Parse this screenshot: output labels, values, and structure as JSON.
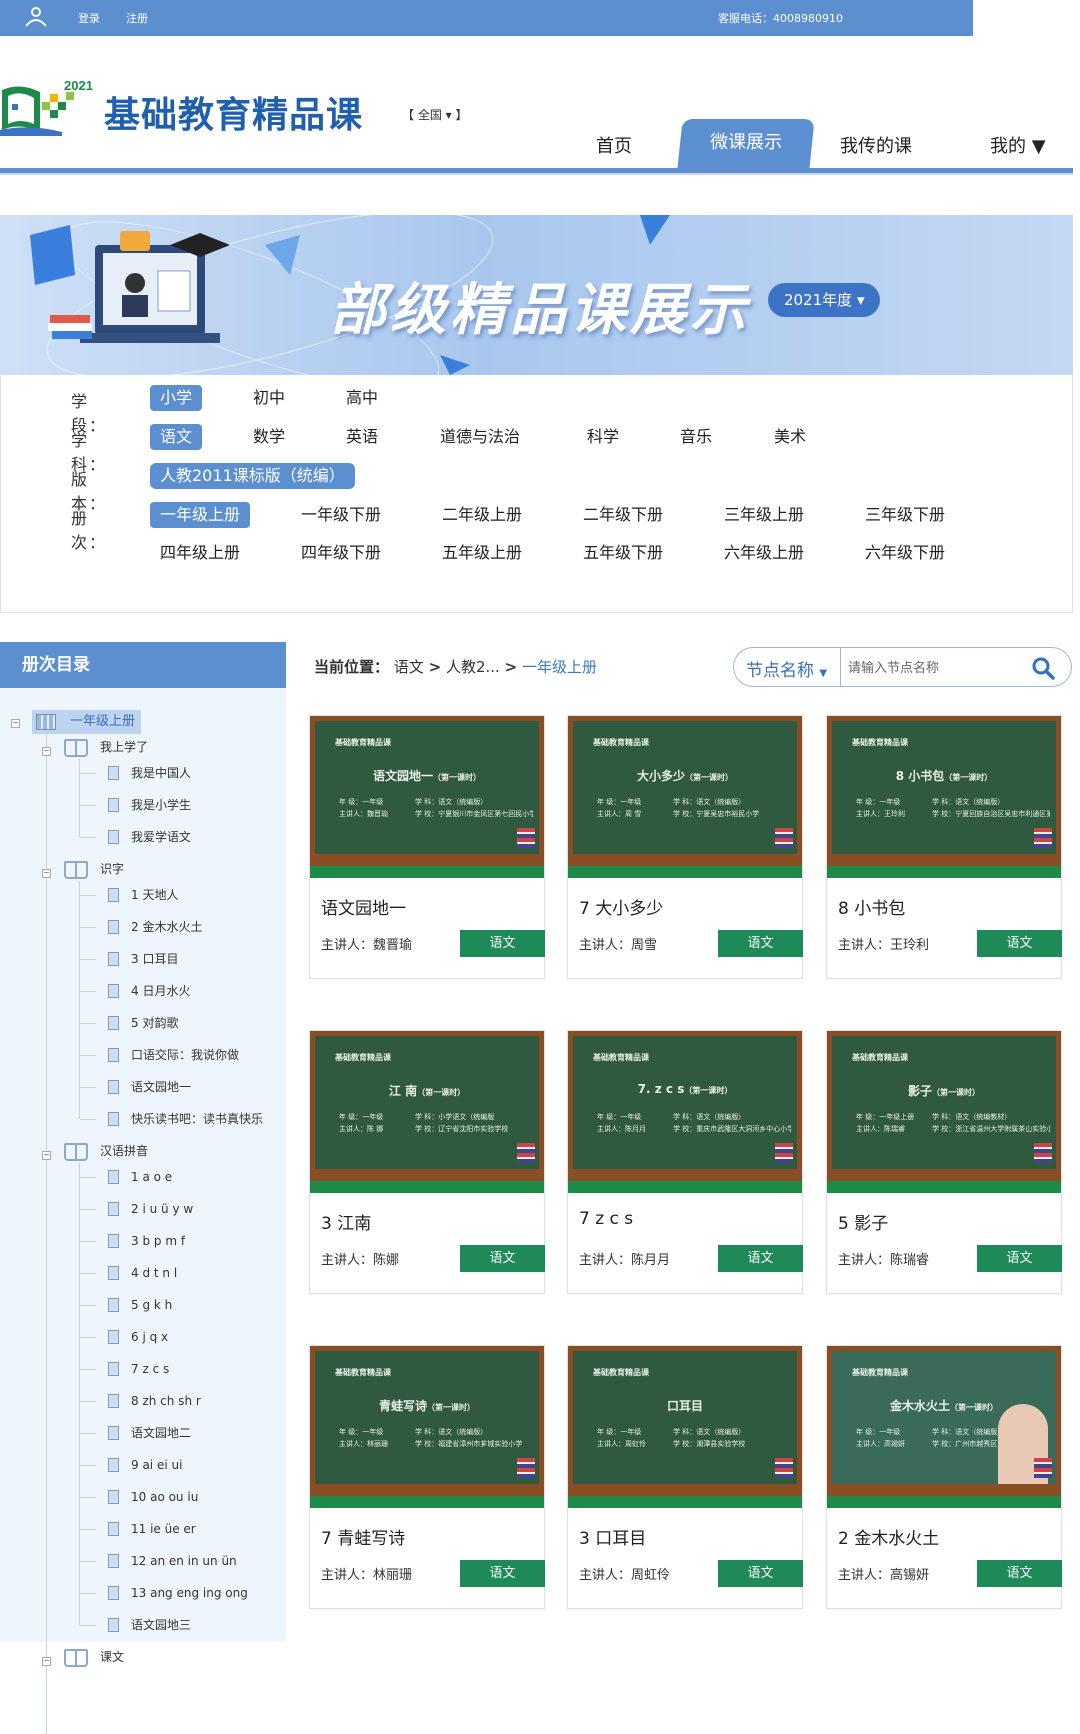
{
  "topbar": {
    "login": "登录",
    "register": "注册",
    "hotline": "客服电话：4008980910"
  },
  "header": {
    "logo_year": "2021",
    "site_title": "基础教育精品课",
    "region": "【 全国 ▾ 】",
    "nav": [
      {
        "label": "首页"
      },
      {
        "label": "微课展示"
      },
      {
        "label": "我传的课"
      },
      {
        "label": "我的 ▼"
      }
    ],
    "active_nav": "微课展示"
  },
  "banner": {
    "title": "部级精品课展示",
    "year_badge": "2021年度 ▾"
  },
  "filters": {
    "stage": {
      "label": "学 段：",
      "options": [
        "小学",
        "初中",
        "高中"
      ],
      "selected": "小学"
    },
    "subject": {
      "label": "学 科：",
      "options": [
        "语文",
        "数学",
        "英语",
        "道德与法治",
        "科学",
        "音乐",
        "美术"
      ],
      "selected": "语文"
    },
    "edition": {
      "label": "版 本：",
      "options": [
        "人教2011课标版（统编）"
      ],
      "selected": "人教2011课标版（统编）"
    },
    "volume": {
      "label": "册 次：",
      "options": [
        "一年级上册",
        "一年级下册",
        "二年级上册",
        "二年级下册",
        "三年级上册",
        "三年级下册",
        "四年级上册",
        "四年级下册",
        "五年级上册",
        "五年级下册",
        "六年级上册",
        "六年级下册"
      ],
      "selected": "一年级上册"
    }
  },
  "sidebar": {
    "title": "册次目录",
    "root": "一年级上册",
    "groups": [
      {
        "label": "我上学了",
        "items": [
          "我是中国人",
          "我是小学生",
          "我爱学语文"
        ]
      },
      {
        "label": "识字",
        "items": [
          "1 天地人",
          "2 金木水火土",
          "3 口耳目",
          "4 日月水火",
          "5 对韵歌",
          "口语交际：我说你做",
          "语文园地一",
          "快乐读书吧：读书真快乐"
        ]
      },
      {
        "label": "汉语拼音",
        "items": [
          "1 a o e",
          "2 i u ü y w",
          "3 b p m f",
          "4 d t n l",
          "5 g k h",
          "6 j q x",
          "7 z c s",
          "8 zh ch sh r",
          "语文园地二",
          "9 ai ei ui",
          "10 ao ou iu",
          "11 ie üe er",
          "12 an en in un ün",
          "13 ang eng ing ong",
          "语文园地三"
        ]
      },
      {
        "label": "课文",
        "items": []
      }
    ]
  },
  "breadcrumb": {
    "label": "当前位置：",
    "items": [
      "语文",
      ">",
      "人教2...",
      ">"
    ],
    "current": "一年级上册"
  },
  "search": {
    "field_select": "节点名称",
    "placeholder": "请输入节点名称"
  },
  "cards": [
    {
      "board_head": "基础教育精品课",
      "board_title": "语文园地一",
      "board_sub": "（第一课时）",
      "grade": "年 级：一年级",
      "subject": "学 科：语文（统编版）",
      "speaker": "主讲人：魏晋瑜",
      "school": "学 校：宁夏银川市金凤区第七回民小学",
      "title": "语文园地一",
      "teacher": "主讲人：魏晋瑜",
      "tag": "语文"
    },
    {
      "board_head": "基础教育精品课",
      "board_title": "大小多少",
      "board_sub": "（第一课时）",
      "grade": "年 级：一年级",
      "subject": "学 科：语文（统编版）",
      "speaker": "主讲人：周 雪",
      "school": "学 校：宁夏吴忠市裕民小学",
      "title": "7 大小多少",
      "teacher": "主讲人：周雪",
      "tag": "语文"
    },
    {
      "board_head": "基础教育精品课",
      "board_title": "8 小书包",
      "board_sub": "（第一课时）",
      "grade": "年 级：一年级",
      "subject": "学 科：语文（统编版）",
      "speaker": "主讲人：王玲利",
      "school": "学 校：宁夏回族自治区吴忠市利通区第七小学",
      "title": "8 小书包",
      "teacher": "主讲人：王玲利",
      "tag": "语文"
    },
    {
      "board_head": "基础教育精品课",
      "board_title": "江 南",
      "board_sub": "（第一课时）",
      "grade": "年 级：一年级",
      "subject": "学 科：小学语文（统编版）",
      "speaker": "主讲人：陈 娜",
      "school": "学 校：辽宁省沈阳市实验学校",
      "title": "3 江南",
      "teacher": "主讲人：陈娜",
      "tag": "语文"
    },
    {
      "board_head": "基础教育精品课",
      "board_title": "7. z c s",
      "board_sub": "（第一课时）",
      "grade": "年 级：一年级",
      "subject": "学 科：语文（统编版）",
      "speaker": "主讲人：陈月月",
      "school": "学 校：重庆市武隆区大洞河乡中心小学校",
      "title": "7 z c s",
      "teacher": "主讲人：陈月月",
      "tag": "语文"
    },
    {
      "board_head": "基础教育精品课",
      "board_title": "影子",
      "board_sub": "（第一课时）",
      "grade": "年 级：一年级上册",
      "subject": "学 科：语文（统编教材）",
      "speaker": "主讲人：陈瑞睿",
      "school": "学 校：浙江省温州大学附属茶山实验小学",
      "title": "5 影子",
      "teacher": "主讲人：陈瑞睿",
      "tag": "语文"
    },
    {
      "board_head": "基础教育精品课",
      "board_title": "青蛙写诗",
      "board_sub": "（第一课时）",
      "grade": "年 级：一年级",
      "subject": "学 科：语文（统编版）",
      "speaker": "主讲人：林丽珊",
      "school": "学 校：福建省漳州市芗城实验小学",
      "title": "7 青蛙写诗",
      "teacher": "主讲人：林丽珊",
      "tag": "语文"
    },
    {
      "board_head": "基础教育精品课",
      "board_title": "口耳目",
      "board_sub": "",
      "grade": "年 级：一年级",
      "subject": "学 科：语文（统编版）",
      "speaker": "主讲人：周虹伶",
      "school": "学 校：湘潭县实验学校",
      "title": "3 口耳目",
      "teacher": "主讲人：周虹伶",
      "tag": "语文"
    },
    {
      "board_head": "基础教育精品课",
      "board_title": "金木水火土",
      "board_sub": "（第一课时）",
      "grade": "年 级：一年级",
      "subject": "学 科：语文（统编版）",
      "speaker": "主讲人：高锡妍",
      "school": "学 校：广州市越秀区",
      "title": "2 金木水火土",
      "teacher": "主讲人：高锡妍",
      "tag": "语文"
    }
  ],
  "colors": {
    "primary": "#5b8fd0",
    "tag_green": "#1e8a58",
    "board": "#2f5a3f",
    "frame": "#8a4e24"
  }
}
